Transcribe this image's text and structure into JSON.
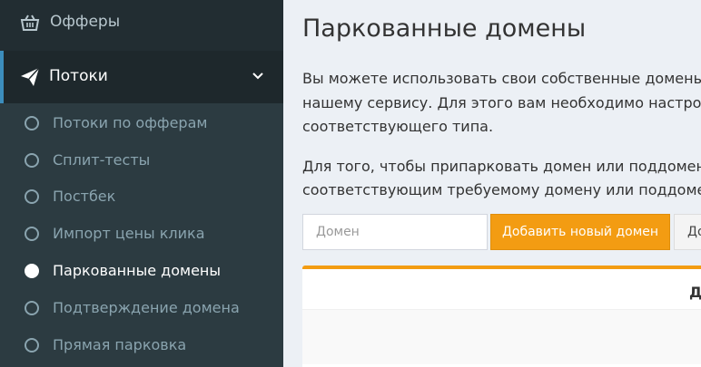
{
  "sidebar": {
    "offers_label": "Офферы",
    "offers_icon": "basket-icon",
    "flows_label": "Потоки",
    "flows_icon": "paper-plane-icon",
    "flows_chevron_icon": "chevron-down-icon",
    "items": [
      {
        "label": "Потоки по офферам"
      },
      {
        "label": "Сплит-тесты"
      },
      {
        "label": "Постбек"
      },
      {
        "label": "Импорт цены клика"
      },
      {
        "label": "Паркованные домены"
      },
      {
        "label": "Подтверждение домена"
      },
      {
        "label": "Прямая парковка"
      }
    ],
    "active_item": "Паркованные домены"
  },
  "main": {
    "title": "Паркованные домены",
    "paragraph1": [
      "Вы можете использовать свои собственные домены",
      "нашему сервису. Для этого вам необходимо настрои",
      "соответствующего типа."
    ],
    "paragraph2": [
      "Для того, чтобы припарковать домен или поддомен,",
      "соответствующим требуемому домену или поддомен"
    ],
    "domain_input": {
      "placeholder": "Домен",
      "value": ""
    },
    "add_button_label": "Добавить новый домен",
    "more_button_label": "До",
    "table_header_partial": "Д"
  },
  "colors": {
    "sidebar_bg": "#222d32",
    "submenu_bg": "#2c3b41",
    "accent_orange": "#f39c12",
    "content_bg": "#ecf0f5"
  }
}
